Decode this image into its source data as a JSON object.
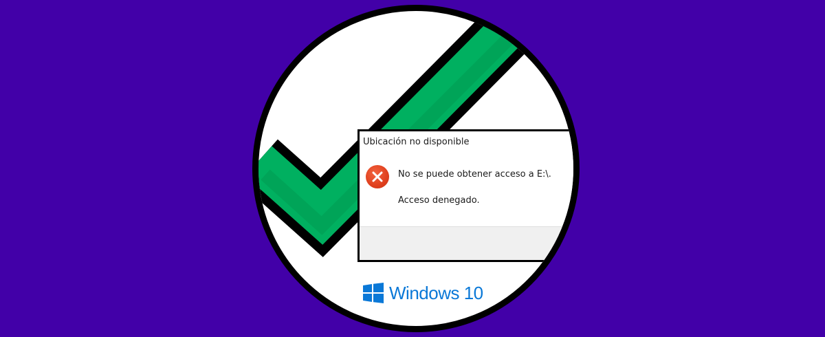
{
  "dialog": {
    "title": "Ubicación no disponible",
    "message_line_1": "No se puede obtener acceso a E:\\.",
    "message_line_2": "Acceso denegado.",
    "icon": "error-x-icon"
  },
  "brand": {
    "text": "Windows 10",
    "logo": "windows-logo-icon",
    "color": "#0a78d7"
  },
  "colors": {
    "background": "#4200a8",
    "checkmark": "#00b060",
    "error": "#e0401e"
  }
}
